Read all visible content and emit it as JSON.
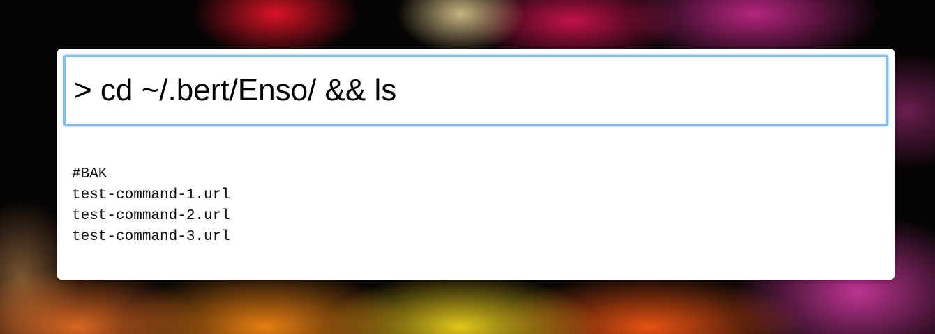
{
  "background": {
    "description": "desktop wallpaper",
    "colors": [
      "#e01428",
      "#d71450",
      "#c8288c",
      "#ff8c14",
      "#fadc1e",
      "#060404"
    ]
  },
  "command_bar": {
    "input_value": "> cd ~/.bert/Enso/ && ls",
    "focus_color": "#86bfe4"
  },
  "output": {
    "lines": [
      "#BAK",
      "test-command-1.url",
      "test-command-2.url",
      "test-command-3.url"
    ]
  }
}
